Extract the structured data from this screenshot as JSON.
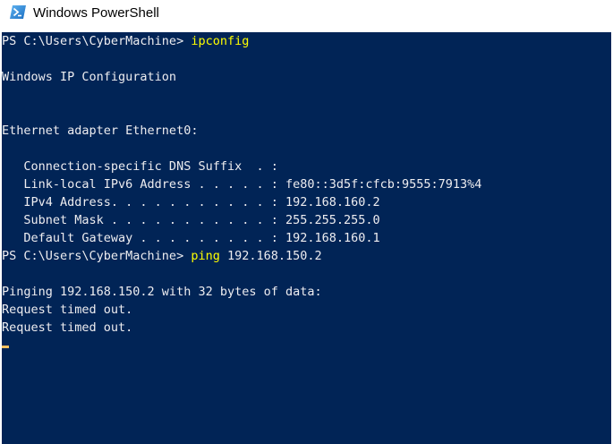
{
  "window": {
    "title": "Windows PowerShell",
    "icon": "powershell-icon"
  },
  "console": {
    "background": "#012456",
    "text_color": "#EEEDF0",
    "command_color": "#FFFF00",
    "cursor_color": "#FDC05F",
    "lines": [
      {
        "prompt": "PS C:\\Users\\CyberMachine> ",
        "command": "ipconfig"
      },
      {
        "text": ""
      },
      {
        "text": "Windows IP Configuration"
      },
      {
        "text": ""
      },
      {
        "text": ""
      },
      {
        "text": "Ethernet adapter Ethernet0:"
      },
      {
        "text": ""
      },
      {
        "text": "   Connection-specific DNS Suffix  . :"
      },
      {
        "text": "   Link-local IPv6 Address . . . . . : fe80::3d5f:cfcb:9555:7913%4"
      },
      {
        "text": "   IPv4 Address. . . . . . . . . . . : 192.168.160.2"
      },
      {
        "text": "   Subnet Mask . . . . . . . . . . . : 255.255.255.0"
      },
      {
        "text": "   Default Gateway . . . . . . . . . : 192.168.160.1"
      },
      {
        "prompt": "PS C:\\Users\\CyberMachine> ",
        "command": "ping",
        "args": " 192.168.150.2"
      },
      {
        "text": ""
      },
      {
        "text": "Pinging 192.168.150.2 with 32 bytes of data:"
      },
      {
        "text": "Request timed out."
      },
      {
        "text": "Request timed out."
      }
    ]
  }
}
